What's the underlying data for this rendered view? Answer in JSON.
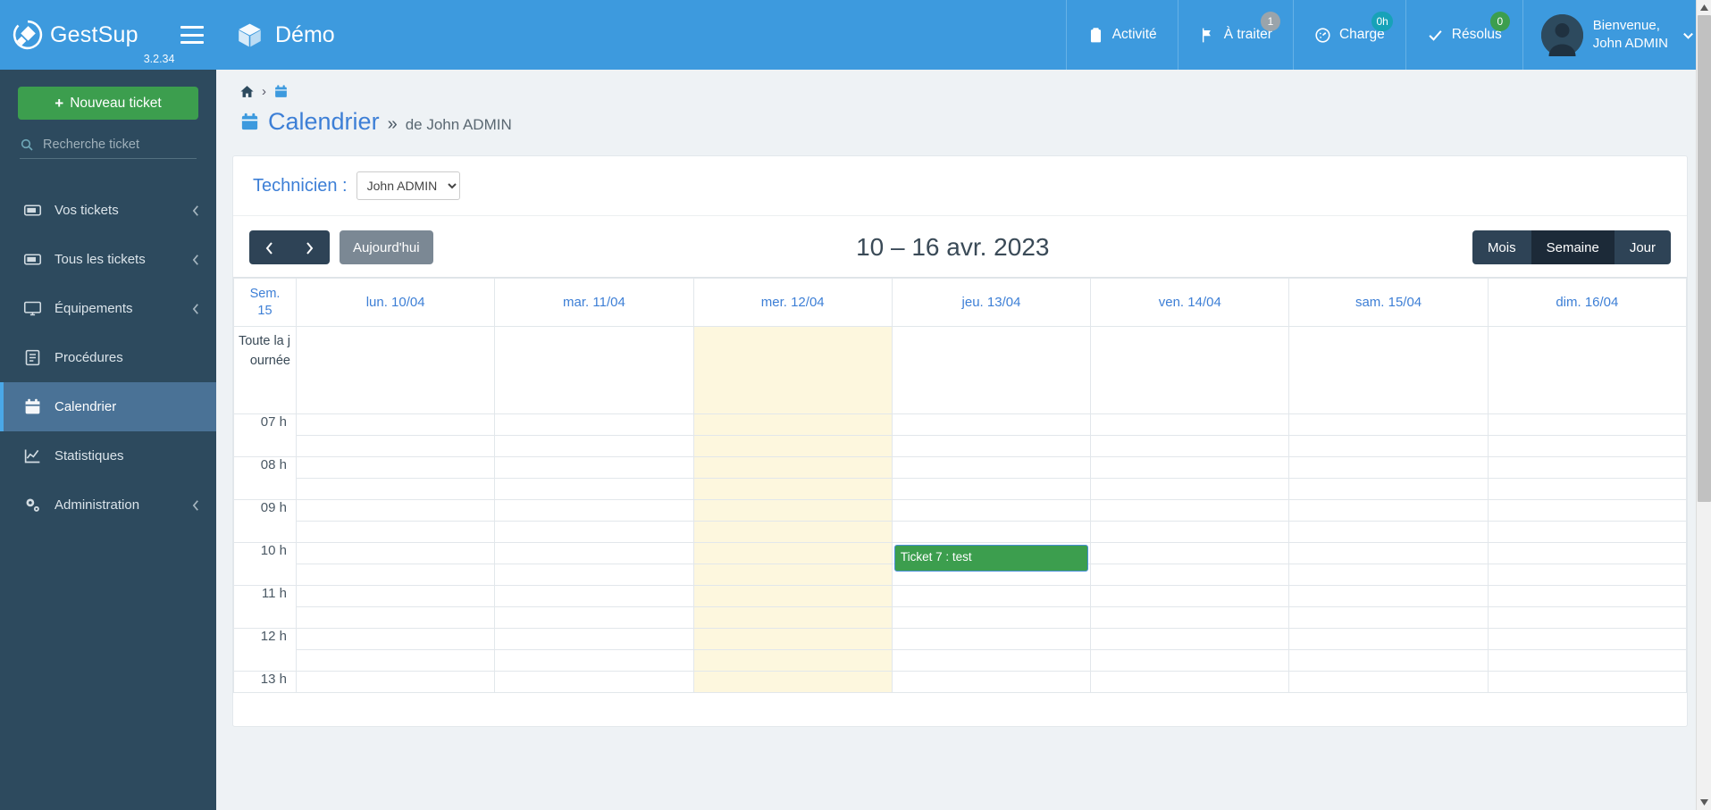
{
  "brand": {
    "logo_icon": "gestsup-logo-icon",
    "name": "GestSup",
    "version": "3.2.34",
    "menu_icon": "hamburger-menu-icon"
  },
  "sidebar": {
    "new_ticket_label": "Nouveau ticket",
    "search": {
      "placeholder": "Recherche ticket",
      "value": "",
      "icon": "search-icon"
    },
    "items": [
      {
        "label": "Vos tickets",
        "icon": "ticket-icon",
        "chevron": true,
        "active": false
      },
      {
        "label": "Tous les tickets",
        "icon": "ticket-icon",
        "chevron": true,
        "active": false
      },
      {
        "label": "Équipements",
        "icon": "monitor-icon",
        "chevron": true,
        "active": false
      },
      {
        "label": "Procédures",
        "icon": "book-icon",
        "chevron": false,
        "active": false
      },
      {
        "label": "Calendrier",
        "icon": "calendar-icon",
        "chevron": false,
        "active": true
      },
      {
        "label": "Statistiques",
        "icon": "chart-line-icon",
        "chevron": false,
        "active": false
      },
      {
        "label": "Administration",
        "icon": "gears-icon",
        "chevron": true,
        "active": false
      }
    ]
  },
  "topbar": {
    "title": "Démo",
    "title_icon": "cube-icon",
    "items": [
      {
        "label": "Activité",
        "icon": "clipboard-icon",
        "badge": null,
        "badge_color": ""
      },
      {
        "label": "À traiter",
        "icon": "flag-icon",
        "badge": "1",
        "badge_color": "#9aa4ab"
      },
      {
        "label": "Charge",
        "icon": "gauge-icon",
        "badge": "0h",
        "badge_color": "#17a2b8"
      },
      {
        "label": "Résolus",
        "icon": "check-icon",
        "badge": "0",
        "badge_color": "#3c9e4e"
      }
    ],
    "user": {
      "greeting": "Bienvenue,",
      "name": "John ADMIN",
      "avatar_icon": "avatar",
      "chevron_icon": "chevron-down-icon"
    }
  },
  "breadcrumb": {
    "home_icon": "home-icon",
    "separator": "›",
    "current_icon": "calendar-icon"
  },
  "page": {
    "icon": "calendar-icon",
    "title": "Calendrier",
    "arrow": "»",
    "subtitle": "de John ADMIN"
  },
  "technician": {
    "label": "Technicien :",
    "selected": "John ADMIN",
    "options": [
      "John ADMIN"
    ]
  },
  "calendar": {
    "prev_icon": "chevron-left-icon",
    "next_icon": "chevron-right-icon",
    "today_label": "Aujourd'hui",
    "title": "10 – 16 avr. 2023",
    "views": [
      {
        "label": "Mois",
        "active": false
      },
      {
        "label": "Semaine",
        "active": true
      },
      {
        "label": "Jour",
        "active": false
      }
    ],
    "week_label": "Sem.",
    "week_number": "15",
    "allday_label": "Toute la journée",
    "days": [
      {
        "label": "lun. 10/04",
        "today": false
      },
      {
        "label": "mar. 11/04",
        "today": false
      },
      {
        "label": "mer. 12/04",
        "today": true
      },
      {
        "label": "jeu. 13/04",
        "today": false
      },
      {
        "label": "ven. 14/04",
        "today": false
      },
      {
        "label": "sam. 15/04",
        "today": false
      },
      {
        "label": "dim. 16/04",
        "today": false
      }
    ],
    "hours": [
      "07 h",
      "08 h",
      "09 h",
      "10 h",
      "11 h",
      "12 h",
      "13 h"
    ],
    "events": [
      {
        "title": "Ticket 7 : test",
        "day_index": 3,
        "hour": "10 h",
        "color": "#3c9e4e",
        "border_color": "#4a90d9"
      }
    ]
  },
  "colors": {
    "brand_blue": "#3d9ade",
    "sidebar": "#2d4a5e",
    "sidebar_active": "#4a7296",
    "green": "#3c9e4e",
    "today_highlight": "#fdf7de",
    "link_blue": "#3d7fd6"
  }
}
